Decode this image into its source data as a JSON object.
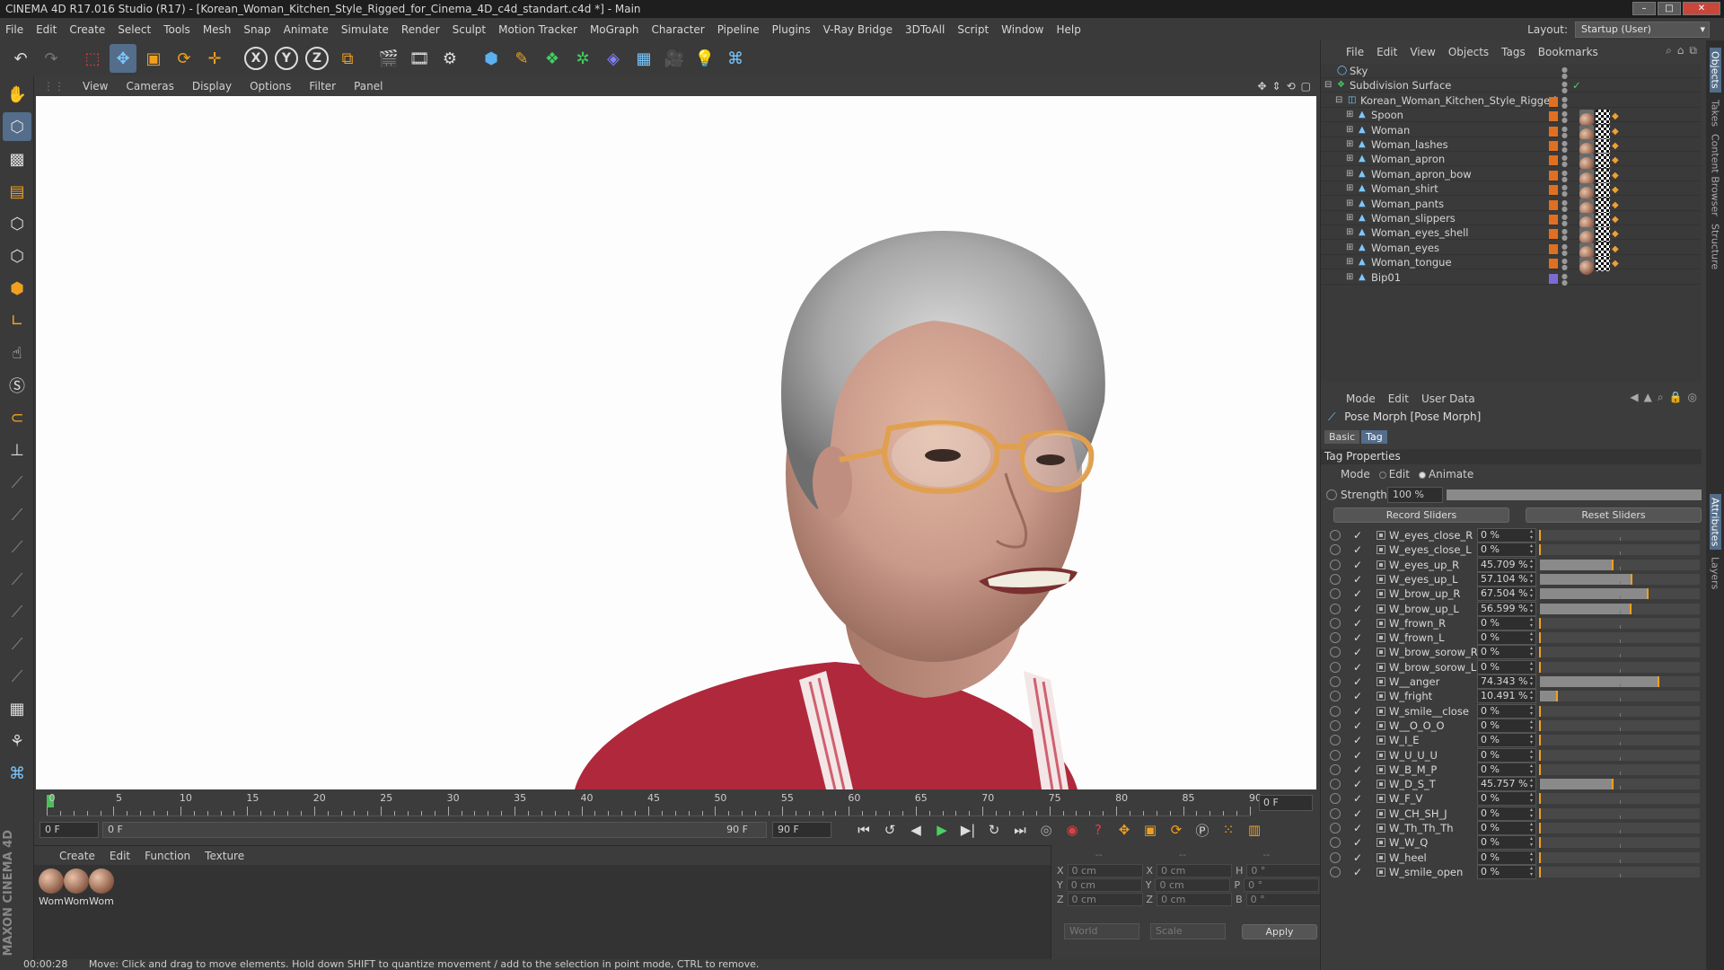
{
  "window": {
    "title": "CINEMA 4D R17.016 Studio (R17) - [Korean_Woman_Kitchen_Style_Rigged_for_Cinema_4D_c4d_standart.c4d *] - Main"
  },
  "menubar": [
    "File",
    "Edit",
    "Create",
    "Select",
    "Tools",
    "Mesh",
    "Snap",
    "Animate",
    "Simulate",
    "Render",
    "Sculpt",
    "Motion Tracker",
    "MoGraph",
    "Character",
    "Pipeline",
    "Plugins",
    "V-Ray Bridge",
    "3DToAll",
    "Script",
    "Window",
    "Help"
  ],
  "layout": {
    "label": "Layout:",
    "value": "Startup (User)"
  },
  "viewport_menu": [
    "View",
    "Cameras",
    "Display",
    "Options",
    "Filter",
    "Panel"
  ],
  "timeline": {
    "labels": [
      "0",
      "5",
      "10",
      "15",
      "20",
      "25",
      "30",
      "35",
      "40",
      "45",
      "50",
      "55",
      "60",
      "65",
      "70",
      "75",
      "80",
      "85",
      "90"
    ],
    "current_frame": "0 F"
  },
  "transport": {
    "start_field": "0 F",
    "range_start": "0 F",
    "range_end": "90 F",
    "end_field": "90 F"
  },
  "material_menu": [
    "Create",
    "Edit",
    "Function",
    "Texture"
  ],
  "materials": [
    "Wom",
    "Wom",
    "Wom"
  ],
  "coords": {
    "header": [
      "--",
      "--",
      "--"
    ],
    "rows": [
      {
        "a": "X",
        "av": "0 cm",
        "b": "X",
        "bv": "0 cm",
        "c": "H",
        "cv": "0 °"
      },
      {
        "a": "Y",
        "av": "0 cm",
        "b": "Y",
        "bv": "0 cm",
        "c": "P",
        "cv": "0 °"
      },
      {
        "a": "Z",
        "av": "0 cm",
        "b": "Z",
        "bv": "0 cm",
        "c": "B",
        "cv": "0 °"
      }
    ],
    "world": "World",
    "scale": "Scale",
    "apply": "Apply"
  },
  "status": {
    "time": "00:00:28",
    "message": "Move: Click and drag to move elements. Hold down SHIFT to quantize movement / add to the selection in point mode, CTRL to remove."
  },
  "object_menu": [
    "File",
    "Edit",
    "View",
    "Objects",
    "Tags",
    "Bookmarks"
  ],
  "objects": [
    {
      "name": "Sky",
      "indent": 0
    },
    {
      "name": "Subdivision Surface",
      "indent": 0
    },
    {
      "name": "Korean_Woman_Kitchen_Style_Rigged",
      "indent": 1
    },
    {
      "name": "Spoon",
      "indent": 2
    },
    {
      "name": "Woman",
      "indent": 2
    },
    {
      "name": "Woman_lashes",
      "indent": 2
    },
    {
      "name": "Woman_apron",
      "indent": 2
    },
    {
      "name": "Woman_apron_bow",
      "indent": 2
    },
    {
      "name": "Woman_shirt",
      "indent": 2
    },
    {
      "name": "Woman_pants",
      "indent": 2
    },
    {
      "name": "Woman_slippers",
      "indent": 2
    },
    {
      "name": "Woman_eyes_shell",
      "indent": 2
    },
    {
      "name": "Woman_eyes",
      "indent": 2
    },
    {
      "name": "Woman_tongue",
      "indent": 2
    },
    {
      "name": "Bip01",
      "indent": 2
    }
  ],
  "attr_menu": [
    "Mode",
    "Edit",
    "User Data"
  ],
  "attr": {
    "title": "Pose Morph [Pose Morph]",
    "tabs": [
      "Basic",
      "Tag"
    ],
    "section": "Tag Properties",
    "mode_label": "Mode",
    "mode_edit": "Edit",
    "mode_animate": "Animate",
    "strength_label": "Strength",
    "strength_value": "100 %",
    "strength": 1.0,
    "record": "Record Sliders",
    "reset": "Reset Sliders"
  },
  "poses": [
    {
      "name": "W_eyes_close_R",
      "text": "0 %",
      "value": 0
    },
    {
      "name": "W_eyes_close_L",
      "text": "0 %",
      "value": 0
    },
    {
      "name": "W_eyes_up_R",
      "text": "45.709 %",
      "value": 45.709
    },
    {
      "name": "W_eyes_up_L",
      "text": "57.104 %",
      "value": 57.104
    },
    {
      "name": "W_brow_up_R",
      "text": "67.504 %",
      "value": 67.504
    },
    {
      "name": "W_brow_up_L",
      "text": "56.599 %",
      "value": 56.599
    },
    {
      "name": "W_frown_R",
      "text": "0 %",
      "value": 0
    },
    {
      "name": "W_frown_L",
      "text": "0 %",
      "value": 0
    },
    {
      "name": "W_brow_sorow_R",
      "text": "0 %",
      "value": 0
    },
    {
      "name": "W_brow_sorow_L",
      "text": "0 %",
      "value": 0
    },
    {
      "name": "W__anger",
      "text": "74.343 %",
      "value": 74.343
    },
    {
      "name": "W_fright",
      "text": "10.491 %",
      "value": 10.491
    },
    {
      "name": "W_smile__close",
      "text": "0 %",
      "value": 0
    },
    {
      "name": "W__O_O_O",
      "text": "0 %",
      "value": 0
    },
    {
      "name": "W_I_E",
      "text": "0 %",
      "value": 0
    },
    {
      "name": "W_U_U_U",
      "text": "0 %",
      "value": 0
    },
    {
      "name": "W_B_M_P",
      "text": "0 %",
      "value": 0
    },
    {
      "name": "W_D_S_T",
      "text": "45.757 %",
      "value": 45.757
    },
    {
      "name": "W_F_V",
      "text": "0 %",
      "value": 0
    },
    {
      "name": "W_CH_SH_J",
      "text": "0 %",
      "value": 0
    },
    {
      "name": "W_Th_Th_Th",
      "text": "0 %",
      "value": 0
    },
    {
      "name": "W_W_Q",
      "text": "0 %",
      "value": 0
    },
    {
      "name": "W_heel",
      "text": "0 %",
      "value": 0
    },
    {
      "name": "W_smile_open",
      "text": "0 %",
      "value": 0
    }
  ],
  "side_tabs": [
    "Objects",
    "Takes",
    "Content Browser",
    "Structure",
    "Attributes",
    "Layers"
  ],
  "branding": "MAXON CINEMA 4D"
}
